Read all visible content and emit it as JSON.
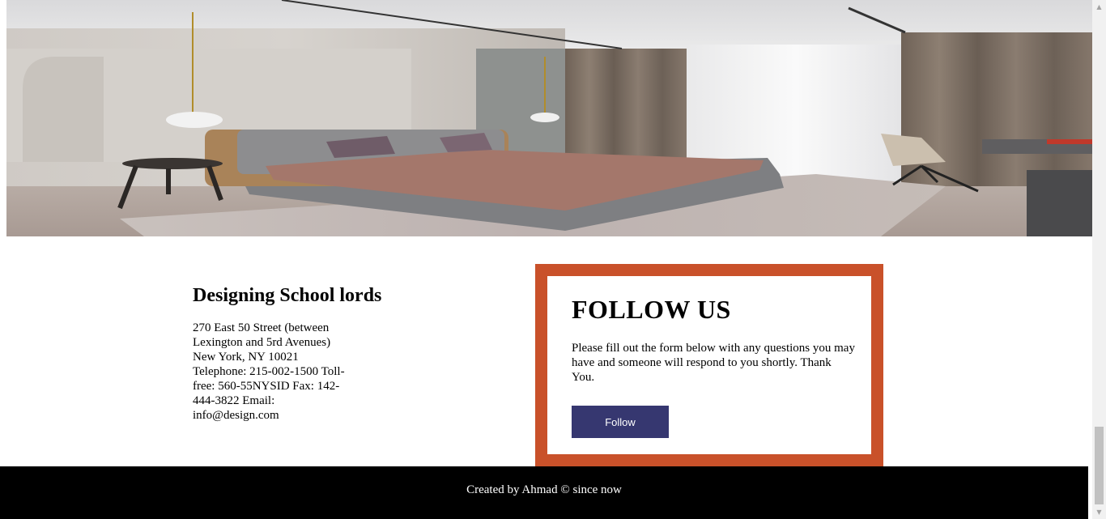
{
  "hero": {
    "alt": "Bedroom interior photo"
  },
  "info": {
    "title": "Designing School lords",
    "address": "270 East 50 Street (between Lexington and 5rd Avenues) New York, NY 10021 Telephone: 215-002-1500 Toll-free: 560-55NYSID Fax: 142-444-3822 Email: info@design.com"
  },
  "follow": {
    "heading": "FOLLOW US",
    "text": "Please fill out the form below with any questions you may have and someone will respond to you shortly. Thank You.",
    "button_label": "Follow",
    "border_color": "#c9512a",
    "button_color": "#363770"
  },
  "footer": {
    "text": "Created by Ahmad © since now"
  },
  "scrollbar": {
    "up_icon": "triangle-up-icon",
    "down_icon": "triangle-down-icon"
  }
}
